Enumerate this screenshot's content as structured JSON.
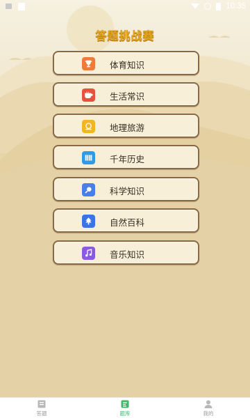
{
  "status_bar": {
    "time": "10:35"
  },
  "title": "答题挑战赛",
  "categories": [
    {
      "label": "体育知识",
      "icon": "trophy-icon",
      "color": "#ee7b3a"
    },
    {
      "label": "生活常识",
      "icon": "coffee-cup-icon",
      "color": "#e5533d"
    },
    {
      "label": "地理旅游",
      "icon": "globe-icon",
      "color": "#f2b526"
    },
    {
      "label": "千年历史",
      "icon": "book-icon",
      "color": "#2d9be8"
    },
    {
      "label": "科学知识",
      "icon": "magnifier-icon",
      "color": "#4a7ee8"
    },
    {
      "label": "自然百科",
      "icon": "tree-icon",
      "color": "#3d73e8"
    },
    {
      "label": "音乐知识",
      "icon": "music-note-icon",
      "color": "#8a5ae0"
    }
  ],
  "bottom_nav": {
    "items": [
      {
        "label": "答题",
        "icon": "quiz-icon",
        "active": false
      },
      {
        "label": "题库",
        "icon": "question-bank-icon",
        "active": true
      },
      {
        "label": "我的",
        "icon": "profile-icon",
        "active": false
      }
    ],
    "active_color": "#3fb86a"
  }
}
